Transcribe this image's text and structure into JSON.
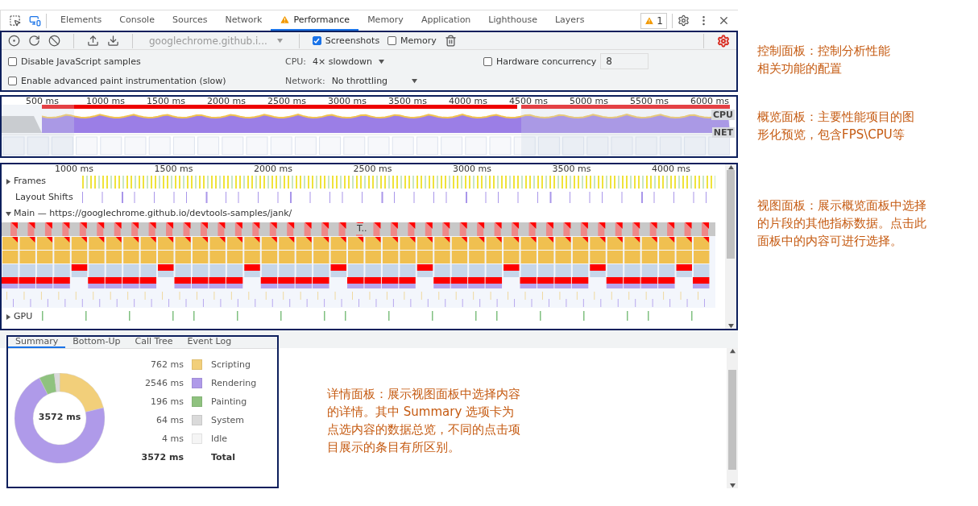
{
  "tabs": [
    {
      "label": "Elements",
      "selected": false,
      "warning": false
    },
    {
      "label": "Console",
      "selected": false,
      "warning": false
    },
    {
      "label": "Sources",
      "selected": false,
      "warning": false
    },
    {
      "label": "Network",
      "selected": false,
      "warning": false
    },
    {
      "label": "Performance",
      "selected": true,
      "warning": true
    },
    {
      "label": "Memory",
      "selected": false,
      "warning": false
    },
    {
      "label": "Application",
      "selected": false,
      "warning": false
    },
    {
      "label": "Lighthouse",
      "selected": false,
      "warning": false
    },
    {
      "label": "Layers",
      "selected": false,
      "warning": false
    }
  ],
  "issues_badge": "1",
  "toolbar": {
    "url": "googlechrome.github.i...",
    "options": [
      {
        "label": "Screenshots",
        "checked": true
      },
      {
        "label": "Memory",
        "checked": false
      }
    ]
  },
  "settings": {
    "disable_js_samples": {
      "label": "Disable JavaScript samples",
      "checked": false
    },
    "paint_instrumentation": {
      "label": "Enable advanced paint instrumentation (slow)",
      "checked": false
    },
    "cpu": {
      "label": "CPU:",
      "value": "4× slowdown"
    },
    "network": {
      "label": "Network:",
      "value": "No throttling"
    },
    "hardware_concurrency": {
      "label": "Hardware concurrency",
      "checked": false,
      "value": "8"
    }
  },
  "overview": {
    "ticks": [
      "500 ms",
      "1000 ms",
      "1500 ms",
      "2000 ms",
      "2500 ms",
      "3000 ms",
      "3500 ms",
      "4000 ms",
      "4500 ms",
      "5000 ms",
      "5500 ms",
      "6000 ms"
    ],
    "tracks": [
      "CPU",
      "NET"
    ]
  },
  "timeline": {
    "ticks": [
      "1000 ms",
      "1500 ms",
      "2000 ms",
      "2500 ms",
      "3000 ms",
      "3500 ms",
      "4000 ms"
    ],
    "task_label": "T..",
    "tracks": [
      {
        "kind": "frames",
        "label": "Frames",
        "expanded": false
      },
      {
        "kind": "shifts",
        "label": "Layout Shifts"
      },
      {
        "kind": "main",
        "label": "Main — https://googlechrome.github.io/devtools-samples/jank/",
        "expanded": true
      },
      {
        "kind": "gpu",
        "label": "GPU",
        "expanded": false
      }
    ]
  },
  "details": {
    "tabs": [
      {
        "label": "Summary",
        "selected": true
      },
      {
        "label": "Bottom-Up",
        "selected": false
      },
      {
        "label": "Call Tree",
        "selected": false
      },
      {
        "label": "Event Log",
        "selected": false
      }
    ],
    "summary": {
      "total_center": "3572 ms",
      "rows": [
        {
          "value": "762 ms",
          "color": "#f2cf7a"
        },
        {
          "value": "2546 ms",
          "color": "#af9ae9"
        },
        {
          "value": "196 ms",
          "color": "#8fc27f"
        },
        {
          "value": "64 ms",
          "color": "#dadada"
        },
        {
          "value": "4 ms",
          "color": "#f5f5f5"
        }
      ],
      "total": {
        "value": "3572 ms",
        "label": "Total"
      },
      "chart_data": {
        "type": "donut",
        "categories": [
          "Scripting",
          "Rendering",
          "Painting",
          "System",
          "Idle"
        ],
        "values": [
          21.3,
          71.3,
          5.5,
          1.8,
          0.1
        ]
      }
    }
  },
  "notes": [
    "控制面板：控制分析性能相关功能的配置",
    "概览面板：主要性能项目的图形化预览，包含FPS\\CPU等",
    "视图面板：展示概览面板中选择的片段的其他指标数据。点击此面板中的内容可进行选择。",
    "详情面板：展示视图面板中选择内容的详情。其中 Summary 选项卡为点选内容的数据总览，不同的点击项目展示的条目有所区别。"
  ]
}
